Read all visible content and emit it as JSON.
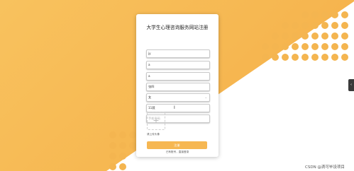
{
  "form": {
    "title": "大学生心理咨询服务网站注册",
    "fields": [
      {
        "value": "jy",
        "placeholder": ""
      },
      {
        "value": "a",
        "placeholder": ""
      },
      {
        "value": "a",
        "placeholder": ""
      },
      {
        "value": "张四",
        "placeholder": ""
      },
      {
        "value": "女",
        "placeholder": ""
      },
      {
        "value": "11蔬",
        "placeholder": ""
      },
      {
        "value": "",
        "placeholder": "手机号码"
      }
    ],
    "upload_plus": "+",
    "upload_label": "请上传头像",
    "register_label": "注册",
    "login_link": "已有账号，直接登录"
  },
  "side_tab_icon": "chevron-left-icon",
  "side_tab_glyph": "‹",
  "watermark": "CSDN @滴可毕设项目",
  "colors": {
    "accent": "#f6b752",
    "dot": "#f4b550"
  }
}
